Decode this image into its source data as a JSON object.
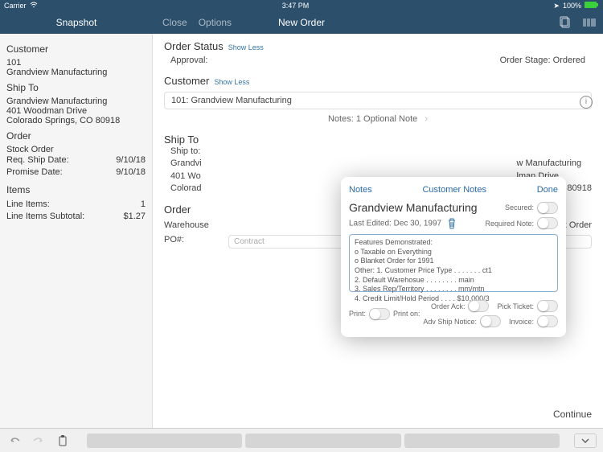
{
  "status": {
    "carrier": "Carrier",
    "time": "3:47 PM",
    "battery": "100%"
  },
  "nav": {
    "snapshot": "Snapshot",
    "close": "Close",
    "options": "Options",
    "title": "New Order"
  },
  "sidebar": {
    "customer_title": "Customer",
    "customer_id": "101",
    "customer_name": "Grandview Manufacturing",
    "shipto_title": "Ship To",
    "ship_name": "Grandview Manufacturing",
    "ship_addr1": "401 Woodman Drive",
    "ship_addr2": "Colorado Springs, CO 80918",
    "order_title": "Order",
    "stock": "Stock Order",
    "req_label": "Req. Ship Date:",
    "req_val": "9/10/18",
    "prom_label": "Promise Date:",
    "prom_val": "9/10/18",
    "items_title": "Items",
    "line_items_label": "Line Items:",
    "line_items_val": "1",
    "subtotal_label": "Line Items Subtotal:",
    "subtotal_val": "$1.27"
  },
  "content": {
    "order_status": "Order Status",
    "show_less": "Show Less",
    "approval": "Approval:",
    "order_stage_label": "Order Stage:",
    "order_stage_val": "Ordered",
    "customer": "Customer",
    "cust_display": "101: Grandview Manufacturing",
    "notes_label": "Notes:",
    "notes_val": "1 Optional Note",
    "ship_to": "Ship To",
    "ship_to_row": "Ship to:",
    "ship_name": "Grandview Manufacturing",
    "ship_addr1": "401 Woodman Drive",
    "ship_addr2": "Colorado Springs, CO 80918",
    "right_ship1": "w Manufacturing",
    "right_ship2": "lman Drive",
    "right_ship3": "Springs, CO 80918",
    "order": "Order",
    "warehouse": "Warehouse",
    "stock_order_label": ": Stock Order",
    "po": "PO#:",
    "po_placeholder": "Contract",
    "continue": "Continue"
  },
  "modal": {
    "notes": "Notes",
    "customer_notes": "Customer Notes",
    "done": "Done",
    "title": "Grandview Manufacturing",
    "secured": "Secured:",
    "last_edited_label": "Last Edited:",
    "last_edited_val": "Dec 30, 1997",
    "required_note": "Required Note:",
    "note_text": "Features Demonstrated:\no Taxable on Everything\no Blanket Order for 1991\nOther: 1. Customer Price Type . . . . . . . ct1\n2. Default Warehosue . . . . . . . . main\n3. Sales Rep/Territory . . . . . . . . mm/mtn\n4. Credit Limit/Hold Period . . . . $10,000/3",
    "print": "Print:",
    "print_on": "Print on:",
    "order_ack": "Order Ack:",
    "pick_ticket": "Pick Ticket:",
    "adv_ship": "Adv Ship Notice:",
    "invoice": "Invoice:"
  }
}
